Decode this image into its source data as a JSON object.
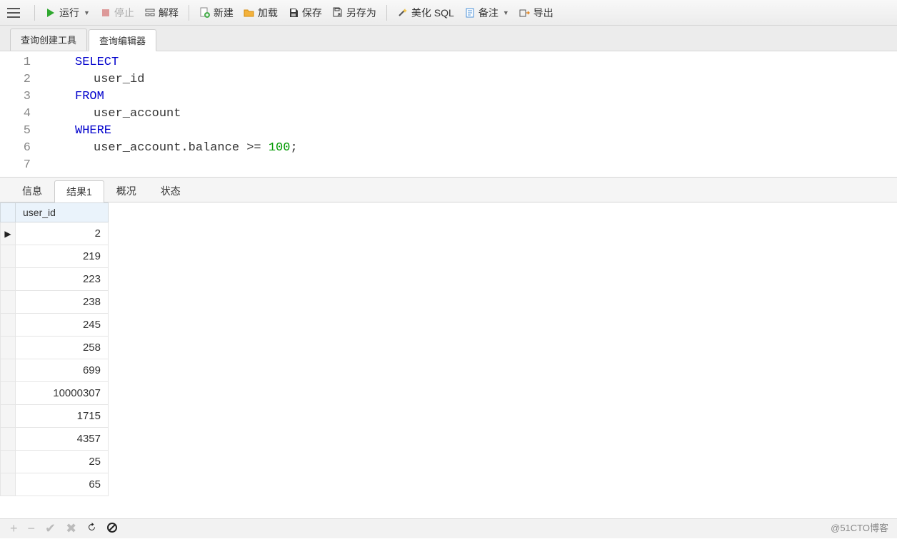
{
  "toolbar": {
    "run": "运行",
    "stop": "停止",
    "explain": "解释",
    "new": "新建",
    "load": "加载",
    "save": "保存",
    "saveas": "另存为",
    "beautify": "美化 SQL",
    "notes": "备注",
    "export": "导出"
  },
  "editorTabs": {
    "builder": "查询创建工具",
    "editor": "查询编辑器"
  },
  "sql": {
    "lines": [
      "1",
      "2",
      "3",
      "4",
      "5",
      "6",
      "7"
    ],
    "l1_kw": "SELECT",
    "l2": "user_id",
    "l3_kw": "FROM",
    "l4": "user_account",
    "l5_kw": "WHERE",
    "l6a": "user_account.balance >= ",
    "l6n": "100",
    "l6p": ";"
  },
  "resultTabs": {
    "info": "信息",
    "result1": "结果1",
    "profile": "概况",
    "status": "状态"
  },
  "grid": {
    "col": "user_id",
    "rows": [
      "2",
      "219",
      "223",
      "238",
      "245",
      "258",
      "699",
      "10000307",
      "1715",
      "4357",
      "25",
      "65"
    ]
  },
  "watermark": "@51CTO博客"
}
